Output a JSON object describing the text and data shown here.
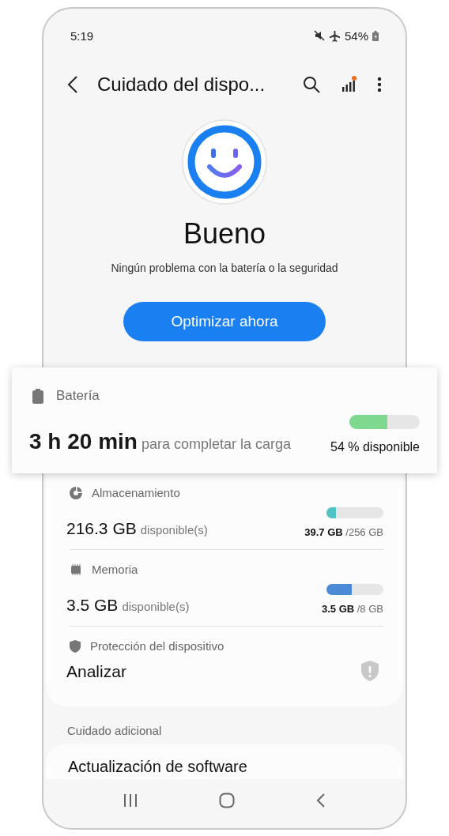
{
  "status_bar": {
    "time": "5:19",
    "battery": "54%"
  },
  "header": {
    "title": "Cuidado del dispo..."
  },
  "status": {
    "label": "Bueno",
    "message": "Ningún problema con la batería o la seguridad"
  },
  "optimize_button": {
    "label": "Optimizar ahora"
  },
  "battery": {
    "label": "Batería",
    "value": "3 h 20 min",
    "detail": "para completar la carga",
    "level": 0.54,
    "color": "#7ed98f",
    "reading": "54 % disponible"
  },
  "items": [
    {
      "kind": "storage",
      "label": "Almacenamiento",
      "value": "216.3 GB",
      "unit": "disponible(s)",
      "level": 0.16,
      "color": "#4fc3c3",
      "reading": "**39.7 GB** /256 GB"
    },
    {
      "kind": "memory",
      "label": "Memoria",
      "value": "3.5 GB",
      "unit": "disponible(s)",
      "level": 0.44,
      "color": "#4a8ad6",
      "reading": "**3.5 GB** /8 GB"
    },
    {
      "kind": "protection",
      "label": "Protección del dispositivo",
      "value": "Analizar"
    }
  ],
  "section_title": "Cuidado adicional",
  "extra_items": [
    {
      "label": "Actualización de software"
    }
  ]
}
